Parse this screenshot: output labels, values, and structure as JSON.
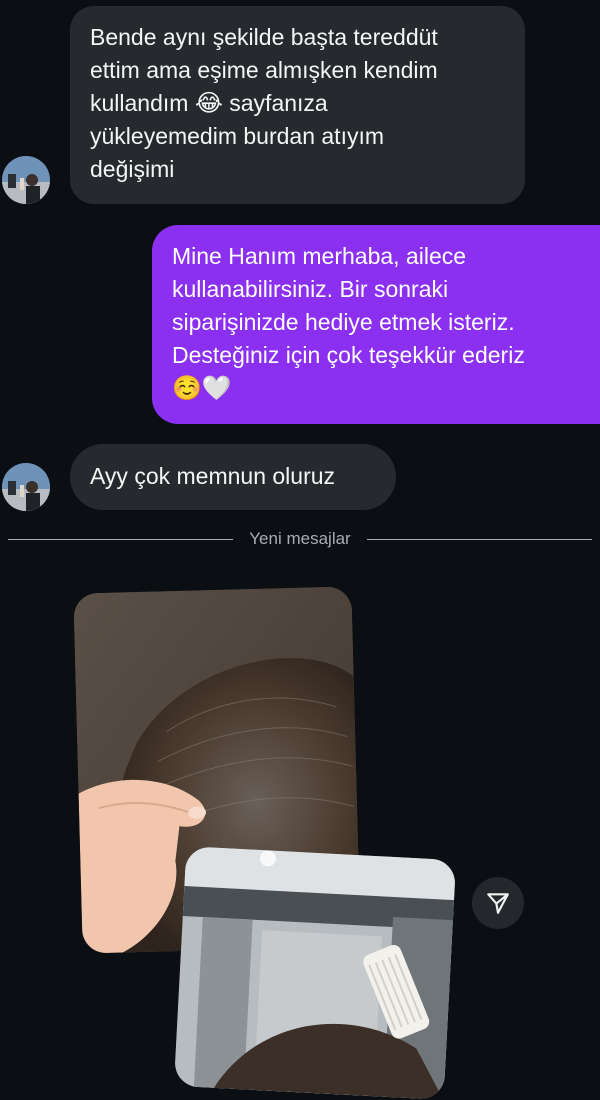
{
  "messages": {
    "incoming_1": {
      "lines": [
        "Bende aynı şekilde başta tereddüt",
        "ettim ama eşime almışken kendim",
        "kullandım",
        "sayfanıza",
        "yükleyemedim burdan atıyım",
        "değişimi"
      ],
      "emoji": "😂"
    },
    "outgoing_1": {
      "lines": [
        "Mine Hanım merhaba, ailece",
        "kullanabilirsiniz. Bir sonraki",
        "siparişinizde hediye etmek isteriz.",
        "Desteğiniz için çok teşekkür ederiz"
      ],
      "emojis": "☺️🤍"
    },
    "incoming_2": {
      "text": "Ayy çok memnun oluruz"
    }
  },
  "divider": {
    "label": "Yeni mesajlar"
  },
  "colors": {
    "background": "#0b0f14",
    "incoming_bubble": "#262a2e",
    "outgoing_bubble": "#8b2ff0"
  },
  "icons": {
    "share": "paper-plane-icon"
  }
}
